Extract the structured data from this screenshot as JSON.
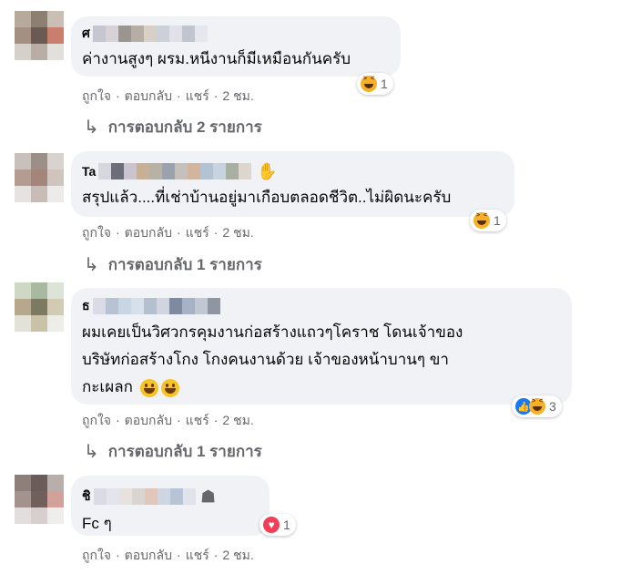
{
  "comments": [
    {
      "name": "ศ",
      "text_lines": [
        "ค่างานสูงๆ ผรม.หนีงานก็มีเหมือนกันครับ"
      ],
      "reaction_count": "1",
      "actions": {
        "like": "ถูกใจ",
        "reply": "ตอบกลับ",
        "share": "แชร์",
        "time": "2 ชม."
      },
      "replies_label": "การตอบกลับ 2 รายการ"
    },
    {
      "name": "Ta",
      "text_lines": [
        "สรุปแล้ว....ที่เช่าบ้านอยู่มาเกือบตลอดชีวิต..ไม่ผิดนะครับ"
      ],
      "reaction_count": "1",
      "actions": {
        "like": "ถูกใจ",
        "reply": "ตอบกลับ",
        "share": "แชร์",
        "time": "2 ชม."
      },
      "replies_label": "การตอบกลับ 1 รายการ"
    },
    {
      "name": "ธ",
      "text_lines": [
        "ผมเคยเป็นวิศวกรคุมงานก่อสร้างแถวๆโคราช โดนเจ้าของ",
        "บริษัทก่อสร้างโกง โกงคนงานด้วย เจ้าของหน้าบานๆ ขา",
        "กะเผลก"
      ],
      "reaction_count": "3",
      "actions": {
        "like": "ถูกใจ",
        "reply": "ตอบกลับ",
        "share": "แชร์",
        "time": "2 ชม."
      },
      "replies_label": "การตอบกลับ 1 รายการ"
    },
    {
      "name": "ชิ",
      "text_lines": [
        "Fc ๆ"
      ],
      "reaction_count": "1",
      "actions": {
        "like": "ถูกใจ",
        "reply": "ตอบกลับ",
        "share": "แชร์",
        "time": "2 ชม."
      }
    }
  ],
  "icons": {
    "reply_arrow": "↳",
    "separator": "·"
  },
  "colors": {
    "bubble": "#f0f2f5",
    "secondary_text": "#65676b",
    "like_blue": "#1877f2",
    "love_red": "#f33e58",
    "haha_yellow": "#f7b125"
  }
}
